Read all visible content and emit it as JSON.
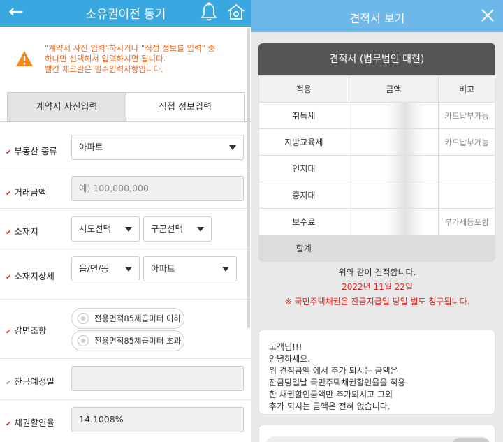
{
  "left": {
    "header": {
      "title": "소유권이전 등기"
    },
    "notice": {
      "line1": "\"계약서 사진 입력\"하시거나 \"직접 정보를 입력\" 중",
      "line2": "하나만 선택해서 입력하시면 됩니다.",
      "line3": "빨간 체크란은 필수입력사항입니다."
    },
    "tabs": {
      "photo": "계약서 사진입력",
      "direct": "직접 정보입력"
    },
    "fields": {
      "property_type": {
        "label": "부동산 종류",
        "value": "아파트"
      },
      "price": {
        "label": "거래금액",
        "placeholder": "예) 100,000,000"
      },
      "location": {
        "label": "소재지",
        "sido": "시도선택",
        "gugun": "구군선택"
      },
      "location_detail": {
        "label": "소재지상세",
        "dong": "읍/면/동",
        "apt": "아파트"
      },
      "reduction": {
        "label": "감면조항",
        "opt1": "전용면적85제곱미터 이하",
        "opt2": "전용면적85제곱미터 초과"
      },
      "balance_date": {
        "label": "잔금예정일",
        "value": ""
      },
      "bond_rate": {
        "label": "채권할인율",
        "value": "14.1008%"
      }
    }
  },
  "right": {
    "header": {
      "title": "견적서 보기"
    },
    "card_title": "견적서 (법무법인 대현)",
    "columns": [
      "적용",
      "금액",
      "비고"
    ],
    "rows": [
      {
        "name": "취득세",
        "note": "카드납부가능"
      },
      {
        "name": "지방교육세",
        "note": "카드납부가능"
      },
      {
        "name": "인지대",
        "note": ""
      },
      {
        "name": "증지대",
        "note": ""
      },
      {
        "name": "보수료",
        "note": "부가세등포함"
      }
    ],
    "total_label": "합계",
    "msg1": "위와 같이 견적합니다.",
    "msg2": "2022년 11월 22일",
    "msg3": "※ 국민주택채권은 잔금지급일 당일 별도 청구됩니다.",
    "box": {
      "l1": "고객님!!!",
      "l2": "안녕하세요.",
      "l3": "위 견적금액 에서 추가 되시는 금액은",
      "l4": "잔금당일날 국민주택채권할인율을 적용",
      "l5": "한 채권할인금액만 추가되시고 그외",
      "l6": "추가 되시는 금액은 전혀 없습니다."
    },
    "colors": {
      "header": "#6cb8e8",
      "red": "#e0201b",
      "accent": "#e8661b"
    }
  }
}
